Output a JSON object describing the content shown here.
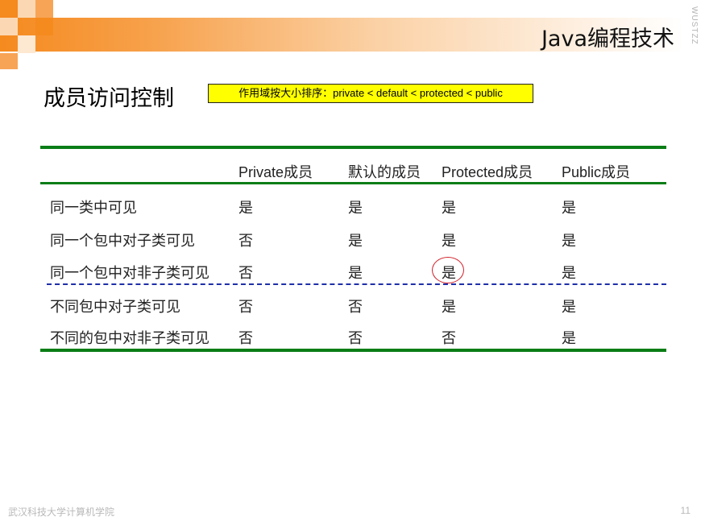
{
  "header": {
    "title": "Java编程技术",
    "watermark": "WUSTZZ"
  },
  "heading": "成员访问控制",
  "note": "作用域按大小排序：private < default < protected < public",
  "table": {
    "columns": [
      "Private成员",
      "默认的成员",
      "Protected成员",
      "Public成员"
    ],
    "rows": [
      {
        "label": "同一类中可见",
        "values": [
          "是",
          "是",
          "是",
          "是"
        ]
      },
      {
        "label": "同一个包中对子类可见",
        "values": [
          "否",
          "是",
          "是",
          "是"
        ]
      },
      {
        "label": "同一个包中对非子类可见",
        "values": [
          "否",
          "是",
          "是",
          "是"
        ]
      },
      {
        "label": "不同包中对子类可见",
        "values": [
          "否",
          "否",
          "是",
          "是"
        ]
      },
      {
        "label": "不同的包中对非子类可见",
        "values": [
          "否",
          "否",
          "否",
          "是"
        ]
      }
    ]
  },
  "footer": {
    "institution": "武汉科技大学计算机学院",
    "page_number": "11"
  },
  "colors": {
    "accent_orange": "#f58a1f",
    "rule_green": "#0a7d16",
    "note_yellow": "#ffff00",
    "highlight_red": "#d0202a",
    "dash_blue": "#1e2fa8"
  }
}
